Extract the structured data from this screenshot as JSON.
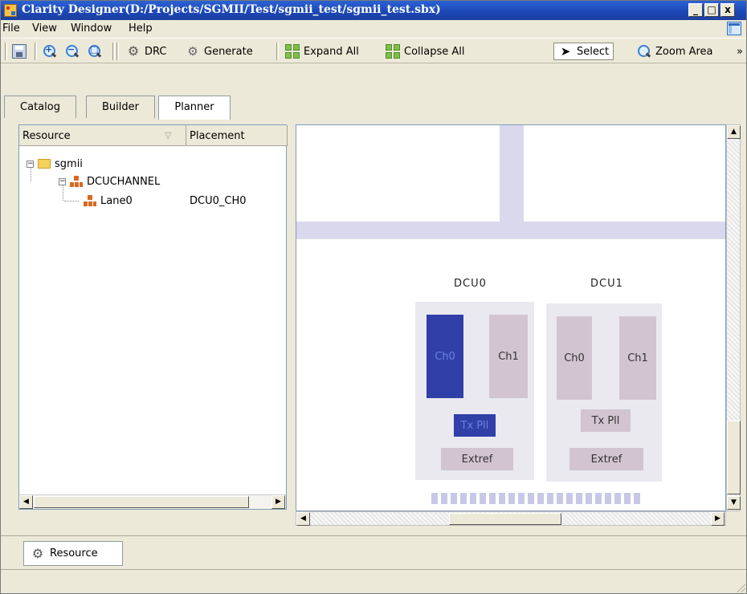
{
  "window": {
    "title": "Clarity Designer(D:/Projects/SGMII/Test/sgmii_test/sgmii_test.sbx)",
    "buttons": {
      "minimize": "_",
      "maximize": "□",
      "close": "x"
    }
  },
  "menu": {
    "items": [
      "File",
      "View",
      "Window",
      "Help"
    ]
  },
  "toolbar": {
    "save": "save-icon",
    "zoom_in": "zoom-in-icon",
    "zoom_out": "zoom-out-icon",
    "zoom_fit": "zoom-fit-icon",
    "drc_label": "DRC",
    "generate_label": "Generate",
    "expand_all_label": "Expand All",
    "collapse_all_label": "Collapse All",
    "select_label": "Select",
    "zoom_area_label": "Zoom Area",
    "overflow": "»"
  },
  "tabs": [
    {
      "label": "Catalog"
    },
    {
      "label": "Builder"
    },
    {
      "label": "Planner",
      "selected": true
    }
  ],
  "resource_panel": {
    "columns": [
      "Resource",
      "Placement"
    ],
    "sort_indicator": "▽",
    "tree": [
      {
        "label": "sgmii",
        "icon": "folder-icon",
        "expander": "−",
        "placement": ""
      },
      {
        "label": "DCUCHANNEL",
        "icon": "network-icon",
        "expander": "−",
        "placement": ""
      },
      {
        "label": "Lane0",
        "icon": "network-icon",
        "placement": "DCU0_CH0"
      }
    ]
  },
  "planner": {
    "dcus": [
      {
        "label": "DCU0",
        "channels": [
          {
            "label": "Ch0",
            "used": true
          },
          {
            "label": "Ch1",
            "used": false
          }
        ],
        "txpll": {
          "label": "Tx Pll",
          "used": true
        },
        "extref": {
          "label": "Extref"
        }
      },
      {
        "label": "DCU1",
        "channels": [
          {
            "label": "Ch0",
            "used": false
          },
          {
            "label": "Ch1",
            "used": false
          }
        ],
        "txpll": {
          "label": "Tx Pll",
          "used": false
        },
        "extref": {
          "label": "Extref"
        }
      }
    ],
    "colors": {
      "used": "#3040a8",
      "unused": "#d3c4d1",
      "bus": "#d9d8ec"
    }
  },
  "bottom_tab": {
    "label": "Resource",
    "icon": "gear-icon"
  },
  "scroll": {
    "left": "◀",
    "right": "▶",
    "up": "▲",
    "down": "▼"
  }
}
